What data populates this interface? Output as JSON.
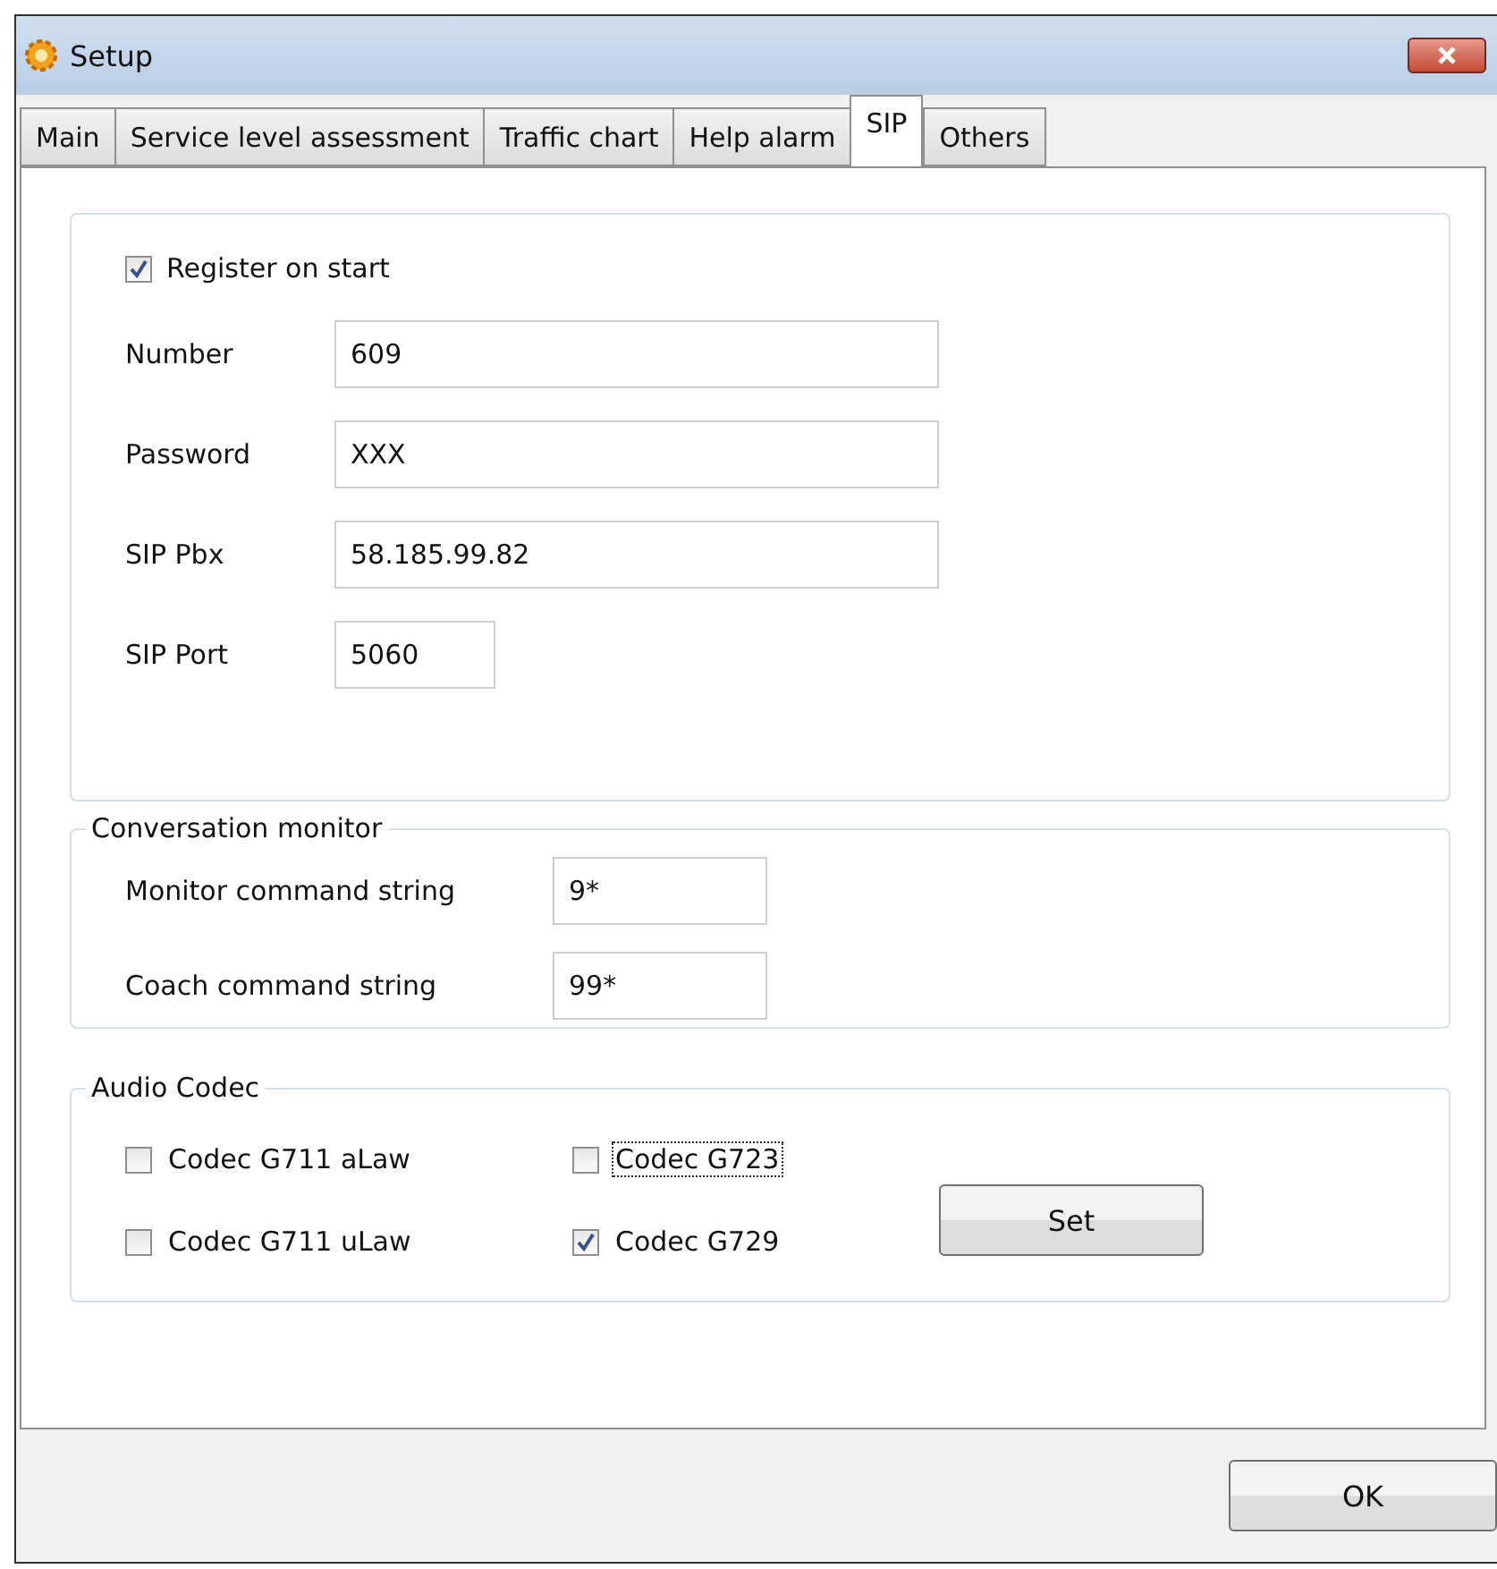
{
  "window": {
    "title": "Setup"
  },
  "tabs": [
    {
      "label": "Main",
      "selected": false
    },
    {
      "label": "Service level assessment",
      "selected": false
    },
    {
      "label": "Traffic chart",
      "selected": false
    },
    {
      "label": "Help alarm",
      "selected": false
    },
    {
      "label": "SIP",
      "selected": true
    },
    {
      "label": "Others",
      "selected": false
    }
  ],
  "registration": {
    "register_on_start": {
      "label": "Register on start",
      "checked": true
    },
    "fields": [
      {
        "label": "Number",
        "value": "609",
        "kind": "wide"
      },
      {
        "label": "Password",
        "value": "XXX",
        "kind": "wide"
      },
      {
        "label": "SIP Pbx",
        "value": "58.185.99.82",
        "kind": "wide"
      },
      {
        "label": "SIP Port",
        "value": "5060",
        "kind": "short"
      }
    ]
  },
  "conversation_monitor": {
    "title": "Conversation monitor",
    "fields": [
      {
        "label": "Monitor command string",
        "value": "9*"
      },
      {
        "label": "Coach command string",
        "value": "99*"
      }
    ]
  },
  "audio_codec": {
    "title": "Audio Codec",
    "options": [
      {
        "label": "Codec G711 aLaw",
        "checked": false,
        "focused": false
      },
      {
        "label": "Codec G711 uLaw",
        "checked": false,
        "focused": false
      },
      {
        "label": "Codec G723",
        "checked": false,
        "focused": true
      },
      {
        "label": "Codec G729",
        "checked": true,
        "focused": false
      }
    ],
    "set_button": "Set"
  },
  "buttons": [
    "OK"
  ]
}
